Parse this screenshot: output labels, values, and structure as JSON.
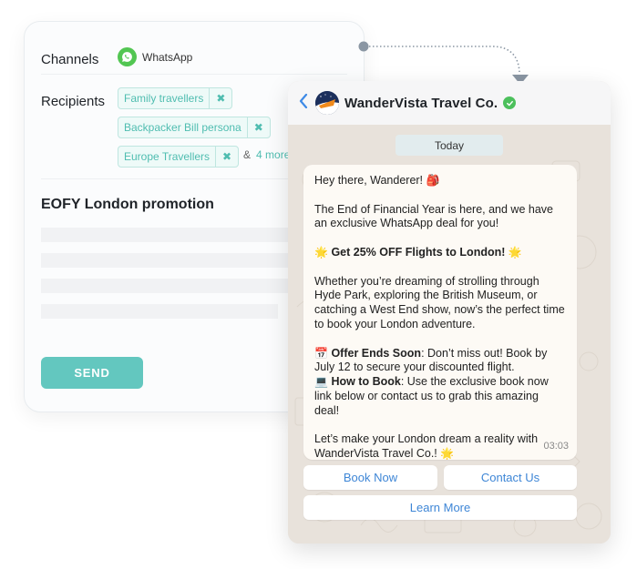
{
  "composer": {
    "channels_label": "Channels",
    "channel": {
      "name": "WhatsApp",
      "icon": "whatsapp-icon",
      "color": "#52c652"
    },
    "recipients_label": "Recipients",
    "recipients": [
      {
        "label": "Family travellers",
        "remove_icon": "close-icon"
      },
      {
        "label": "Backpacker Bill persona",
        "remove_icon": "close-icon"
      },
      {
        "label": "Europe Travellers",
        "remove_icon": "close-icon"
      }
    ],
    "more_prefix": "&",
    "more_link": "4 more",
    "message_title": "EOFY London promotion",
    "send_label": "SEND",
    "accent_color": "#63c7bf"
  },
  "preview": {
    "back_icon": "chevron-left-icon",
    "business_name": "WanderVista Travel Co.",
    "verified_icon": "verified-check-icon",
    "date_label": "Today",
    "message": {
      "greeting": "Hey there, Wanderer!",
      "greeting_emoji": "🎒",
      "intro": "The End of Financial Year is here, and we have an exclusive WhatsApp deal for you!",
      "headline_emoji": "🌟",
      "headline": "Get 25% OFF Flights to London!",
      "body": "Whether you’re dreaming of strolling through Hyde Park, exploring the British Museum, or catching a West End show, now’s the perfect time to book your London adventure.",
      "offer_emoji": "📅",
      "offer_title": "Offer Ends Soon",
      "offer_text": ": Don’t miss out! Book by July 12 to secure your discounted flight.",
      "howto_emoji": "💻",
      "howto_title": "How to Book",
      "howto_text": ": Use the exclusive book now link below or contact us to grab this amazing deal!",
      "closing": "Let’s make your London dream a reality with WanderVista Travel Co.!",
      "closing_emoji": "🌟",
      "time": "03:03"
    },
    "buttons": [
      {
        "label": "Book Now"
      },
      {
        "label": "Contact Us"
      },
      {
        "label": "Learn More"
      }
    ],
    "link_color": "#3e86d6"
  }
}
